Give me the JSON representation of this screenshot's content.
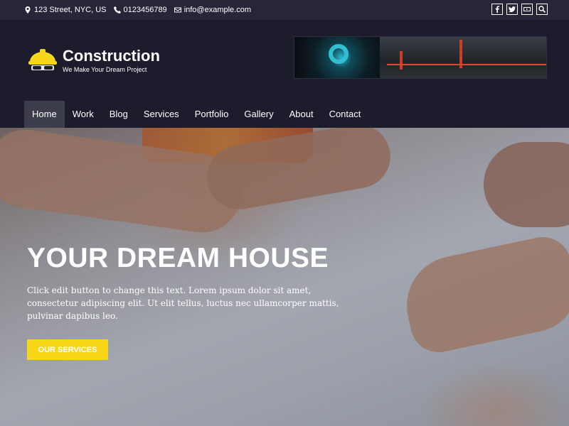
{
  "topbar": {
    "address": "123 Street, NYC, US",
    "phone": "0123456789",
    "email": "info@example.com",
    "social": [
      "facebook-icon",
      "twitter-icon",
      "youtube-icon",
      "search-icon"
    ]
  },
  "header": {
    "brand": "Construction",
    "tagline": "We Make Your Dream Project"
  },
  "nav": {
    "items": [
      "Home",
      "Work",
      "Blog",
      "Services",
      "Portfolio",
      "Gallery",
      "About",
      "Contact"
    ],
    "active": "Home"
  },
  "hero": {
    "title": "YOUR DREAM HOUSE",
    "text": "Click edit button to change this text. Lorem ipsum dolor sit amet, consectetur adipiscing elit. Ut elit tellus, luctus nec ullamcorper mattis, pulvinar dapibus leo.",
    "button": "OUR SERVICES"
  },
  "colors": {
    "accent": "#f8d61a",
    "header_bg": "#1c1c2c",
    "topbar_bg": "#262638"
  }
}
